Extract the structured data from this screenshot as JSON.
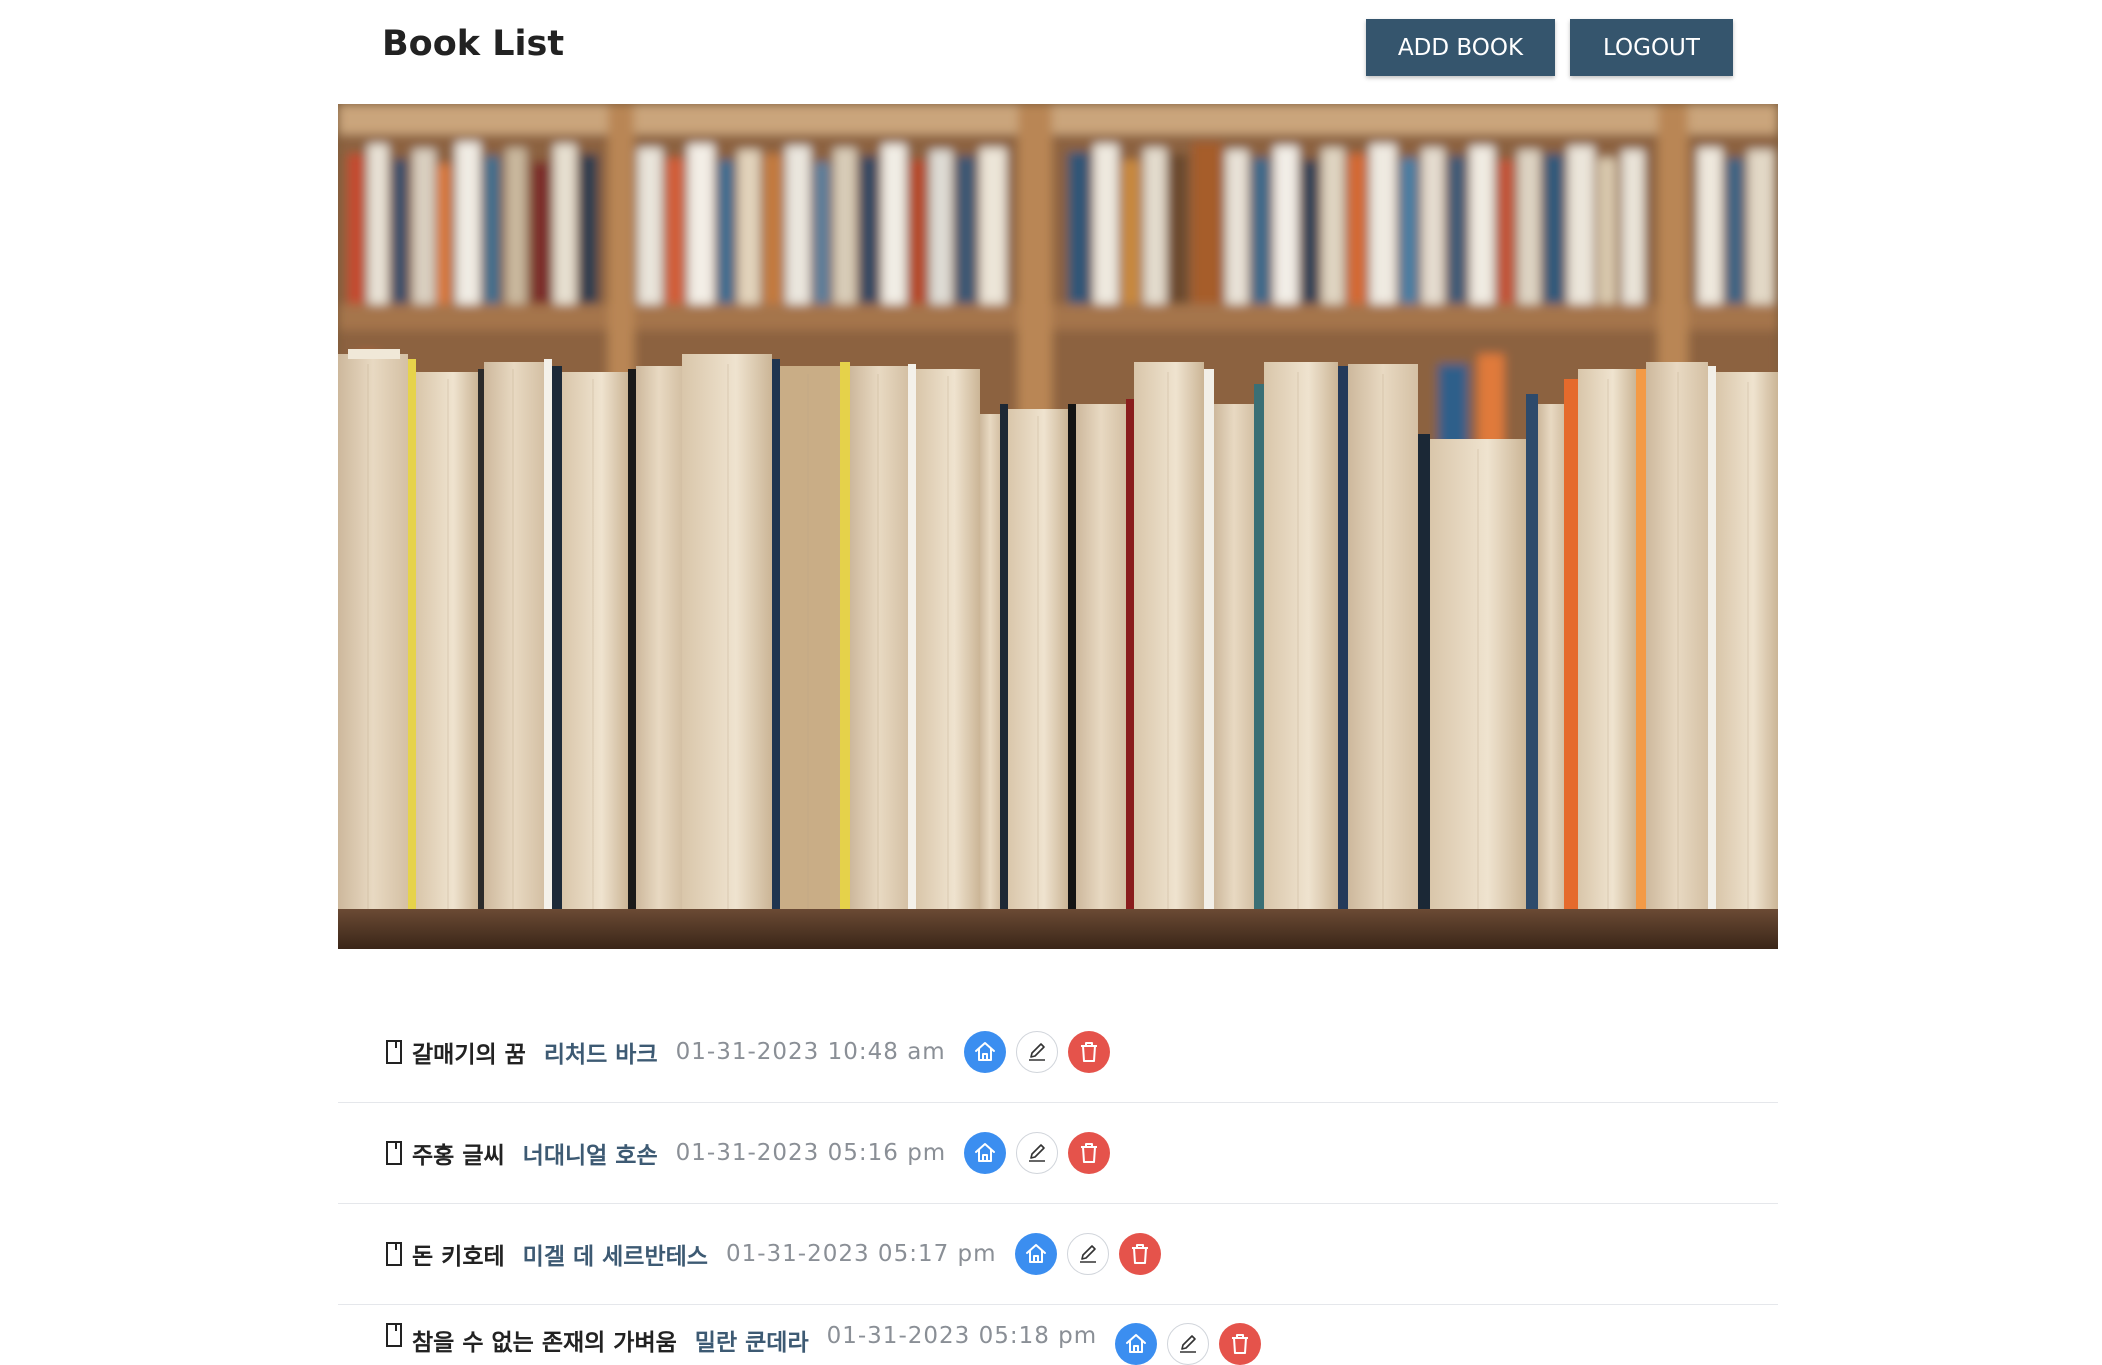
{
  "header": {
    "title": "Book List",
    "add_label": "ADD BOOK",
    "logout_label": "LOGOUT"
  },
  "hero": {
    "image": "bookshelf-photo"
  },
  "colors": {
    "primary_button": "#35556d",
    "home_icon_bg": "#3b8ef0",
    "delete_icon_bg": "#e5534b",
    "author_text": "#3d5a73"
  },
  "books": [
    {
      "title": "갈매기의 꿈",
      "author": "리처드 바크",
      "date": "01-31-2023 10:48 am"
    },
    {
      "title": "주홍 글씨",
      "author": "너대니얼 호손",
      "date": "01-31-2023 05:16 pm"
    },
    {
      "title": "돈 키호테",
      "author": "미겔 데 세르반테스",
      "date": "01-31-2023 05:17 pm"
    },
    {
      "title": "참을 수 없는 존재의 가벼움",
      "author": "밀란 쿤데라",
      "date": "01-31-2023 05:18 pm"
    }
  ],
  "icons": {
    "book": "book-icon",
    "home": "home-icon",
    "edit": "pencil-icon",
    "delete": "trash-icon"
  }
}
